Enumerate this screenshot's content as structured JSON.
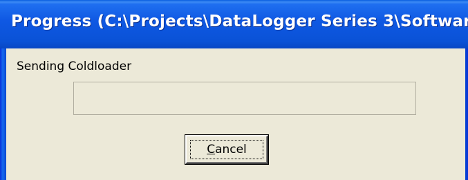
{
  "window": {
    "title": "Progress (C:\\Projects\\DataLogger Series 3\\Softwar..."
  },
  "status": {
    "message": "Sending Coldloader"
  },
  "progress": {
    "fraction": 0
  },
  "buttons": {
    "cancel_mnemonic": "C",
    "cancel_rest": "ancel"
  },
  "colors": {
    "titlebar": "#0a52d6",
    "dialog_background": "#ece9d8",
    "progress_fill": "#2fbd3a"
  }
}
